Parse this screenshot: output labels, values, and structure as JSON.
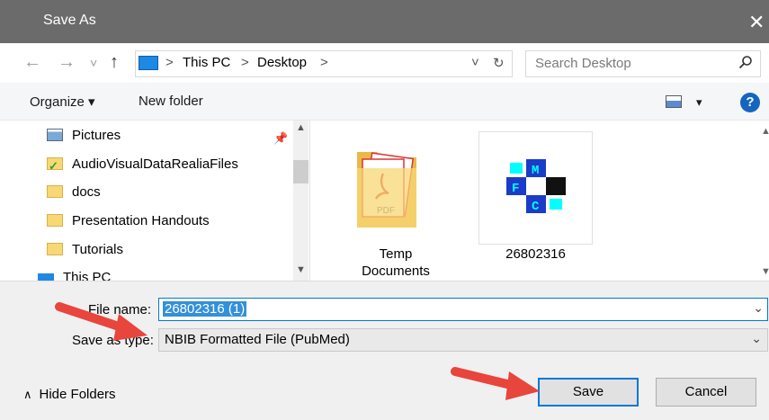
{
  "window": {
    "title": "Save As",
    "close_glyph": "✕",
    "app_icon": "chrome-icon"
  },
  "nav": {
    "back": "←",
    "forward": "→",
    "recent": "˅",
    "up": "↑",
    "breadcrumb": [
      "This PC",
      "Desktop"
    ],
    "sep": ">",
    "dropdown": "˅",
    "refresh": "↻"
  },
  "search": {
    "placeholder": "Search Desktop",
    "icon": "search-icon"
  },
  "toolbar": {
    "organize": "Organize ▾",
    "new_folder": "New folder",
    "view_dropdown": "▾",
    "help": "?"
  },
  "sidebar": {
    "items": [
      {
        "label": "Pictures",
        "icon": "pictures-icon"
      },
      {
        "label": "AudioVisualDataRealiaFiles",
        "icon": "synced-folder-icon"
      },
      {
        "label": "docs",
        "icon": "folder-icon"
      },
      {
        "label": "Presentation Handouts",
        "icon": "folder-icon"
      },
      {
        "label": "Tutorials",
        "icon": "folder-icon"
      }
    ],
    "partial_label": "This PC"
  },
  "files": [
    {
      "label": "Temp Documents",
      "icon": "pdf-folder-icon"
    },
    {
      "label": "26802316",
      "icon": "mfc-file-icon"
    }
  ],
  "form": {
    "filename_label": "File name:",
    "filename_value": "26802316 (1)",
    "savetype_label": "Save as type:",
    "savetype_value": "NBIB Formatted File (PubMed)"
  },
  "footer": {
    "hide_folders": "Hide Folders",
    "save": "Save",
    "cancel": "Cancel"
  },
  "colors": {
    "titlebar": "#6b6b6b",
    "accent": "#0078d7",
    "arrow": "#e8453c",
    "help": "#1565c0"
  }
}
